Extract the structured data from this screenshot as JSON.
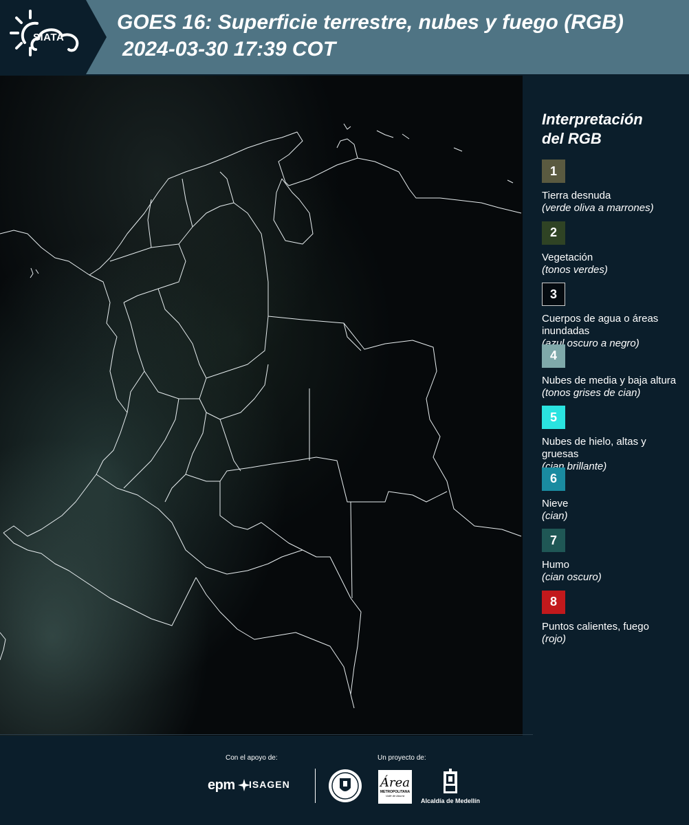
{
  "header": {
    "logo_text": "SIATA",
    "title": "GOES 16: Superficie terrestre, nubes y fuego (RGB)",
    "datetime": "2024-03-30 17:39 COT"
  },
  "legend": {
    "title_line1": "Interpretación",
    "title_line2": "del RGB",
    "items": [
      {
        "num": "1",
        "color": "#5a5a40",
        "label": "Tierra desnuda",
        "desc": "(verde oliva a marrones)"
      },
      {
        "num": "2",
        "color": "#2f4324",
        "label": "Vegetación",
        "desc": "(tonos verdes)"
      },
      {
        "num": "3",
        "color": "#050b10",
        "label": "Cuerpos de agua o áreas inundadas",
        "desc": "(azul oscuro a negro)"
      },
      {
        "num": "4",
        "color": "#7fa9aa",
        "label": "Nubes de media y baja altura",
        "desc": "(tonos grises de cian)"
      },
      {
        "num": "5",
        "color": "#2ae3e0",
        "label": "Nubes de hielo, altas y gruesas",
        "desc": "(cian brillante)"
      },
      {
        "num": "6",
        "color": "#1a8ba0",
        "label": "Nieve",
        "desc": "(cian)"
      },
      {
        "num": "7",
        "color": "#1f5755",
        "label": "Humo",
        "desc": "(cian oscuro)"
      },
      {
        "num": "8",
        "color": "#c2191c",
        "label": "Puntos calientes, fuego",
        "desc": "(rojo)"
      }
    ]
  },
  "footer": {
    "support_label": "Con el apoyo de:",
    "project_label": "Un proyecto de:",
    "epm": "epm",
    "isagen": "ISAGEN",
    "area_big": "Área",
    "area_small": "METROPOLITANA",
    "area_tiny": "Valle de Aburrá",
    "alcaldia": "Alcaldía de Medellín"
  }
}
